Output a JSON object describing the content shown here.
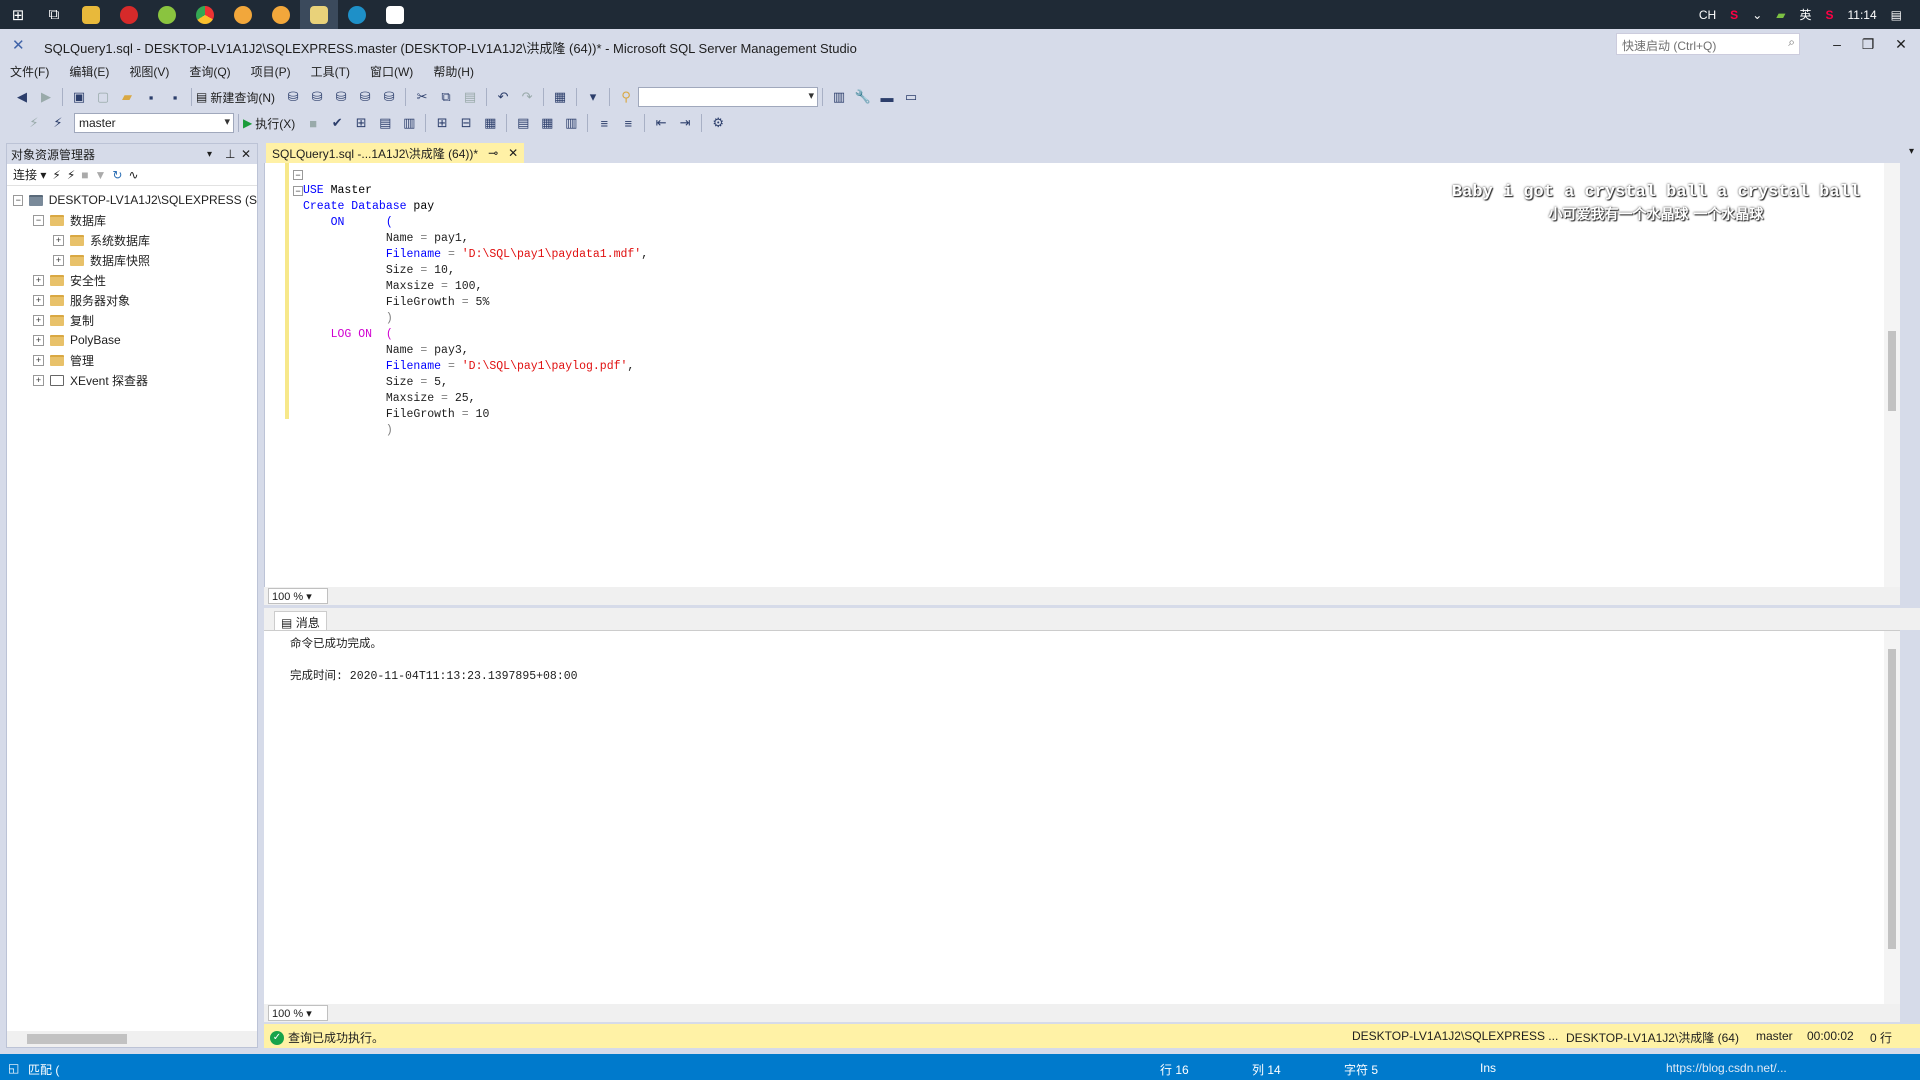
{
  "taskbar": {
    "tray": {
      "lang": "CH",
      "ime": "英",
      "time": "11:14"
    }
  },
  "window": {
    "title": "SQLQuery1.sql - DESKTOP-LV1A1J2\\SQLEXPRESS.master (DESKTOP-LV1A1J2\\洪成隆 (64))* - Microsoft SQL Server Management Studio",
    "quick_launch_placeholder": "快速启动 (Ctrl+Q)"
  },
  "menu": [
    "文件(F)",
    "编辑(E)",
    "视图(V)",
    "查询(Q)",
    "项目(P)",
    "工具(T)",
    "窗口(W)",
    "帮助(H)"
  ],
  "toolbar1": {
    "new_query": "新建查询(N)"
  },
  "toolbar2": {
    "database": "master",
    "execute": "执行(X)"
  },
  "object_explorer": {
    "title": "对象资源管理器",
    "connect": "连接",
    "tree": [
      {
        "label": "DESKTOP-LV1A1J2\\SQLEXPRESS (S",
        "level": 0,
        "expanded": true,
        "icon": "server"
      },
      {
        "label": "数据库",
        "level": 1,
        "expanded": true,
        "icon": "folder"
      },
      {
        "label": "系统数据库",
        "level": 2,
        "expanded": false,
        "icon": "folder"
      },
      {
        "label": "数据库快照",
        "level": 2,
        "expanded": false,
        "icon": "folder"
      },
      {
        "label": "安全性",
        "level": 1,
        "expanded": false,
        "icon": "folder"
      },
      {
        "label": "服务器对象",
        "level": 1,
        "expanded": false,
        "icon": "folder"
      },
      {
        "label": "复制",
        "level": 1,
        "expanded": false,
        "icon": "folder"
      },
      {
        "label": "PolyBase",
        "level": 1,
        "expanded": false,
        "icon": "folder"
      },
      {
        "label": "管理",
        "level": 1,
        "expanded": false,
        "icon": "folder"
      },
      {
        "label": "XEvent 探查器",
        "level": 1,
        "expanded": false,
        "icon": "xevent"
      }
    ]
  },
  "editor": {
    "tab_label": "SQLQuery1.sql -...1A1J2\\洪成隆 (64))*",
    "code": [
      "USE Master",
      "Create Database pay",
      "    ON      (",
      "            Name = pay1,",
      "            Filename = 'D:\\SQL\\pay1\\paydata1.mdf',",
      "            Size = 10,",
      "            Maxsize = 100,",
      "            FileGrowth = 5%",
      "            )",
      "    LOG ON  (",
      "            Name = pay3,",
      "            Filename = 'D:\\SQL\\pay1\\paylog.pdf',",
      "            Size = 5,",
      "            Maxsize = 25,",
      "            FileGrowth = 10",
      "            )"
    ],
    "overlay_line1": "Baby i got a crystal ball a crystal ball",
    "overlay_line2": "小可爱我有一个水晶球 一个水晶球",
    "zoom": "100 %"
  },
  "results": {
    "tab_label": "消息",
    "message": "命令已成功完成。",
    "completion_time": "完成时间: 2020-11-04T11:13:23.1397895+08:00",
    "zoom": "100 %"
  },
  "query_status": {
    "text": "查询已成功执行。",
    "server": "DESKTOP-LV1A1J2\\SQLEXPRESS ...",
    "user": "DESKTOP-LV1A1J2\\洪成隆 (64)",
    "database": "master",
    "elapsed": "00:00:02",
    "rows": "0 行"
  },
  "statusbar": {
    "left": "匹配 (",
    "line": "行 16",
    "col": "列 14",
    "ch": "字符 5",
    "mode": "Ins",
    "watermark": "https://blog.csdn.net/..."
  },
  "colors": {
    "accent": "#007acc",
    "query_ok_bg": "#fff2a6",
    "keyword": "#0000ff",
    "string": "#e01010"
  }
}
